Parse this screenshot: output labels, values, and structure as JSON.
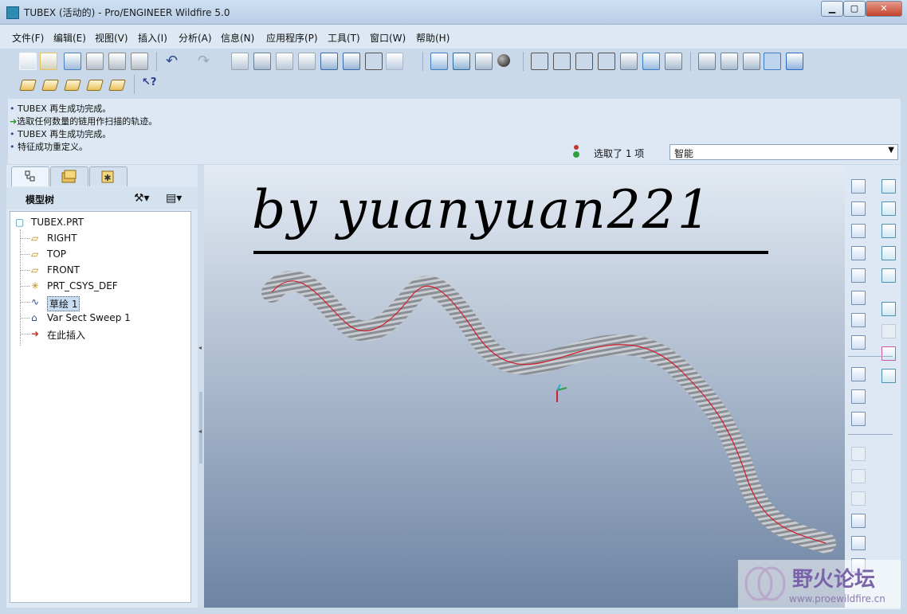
{
  "window": {
    "title": "TUBEX (活动的) - Pro/ENGINEER Wildfire 5.0",
    "min_label": "▁",
    "max_label": "▢",
    "close_label": "✕"
  },
  "menu": [
    "文件(F)",
    "编辑(E)",
    "视图(V)",
    "插入(I)",
    "分析(A)",
    "信息(N)",
    "应用程序(P)",
    "工具(T)",
    "窗口(W)",
    "帮助(H)"
  ],
  "toolbar_icons": [
    "new-icon",
    "open-icon",
    "save-icon",
    "print-icon",
    "print-preview-icon",
    "quick-print-icon",
    "undo-icon",
    "redo-icon",
    "cut-icon",
    "copy-icon",
    "paste-icon",
    "paste-special-icon",
    "regenerate-icon",
    "regen-manager-icon",
    "find-icon",
    "select-box-icon",
    "repaint-icon",
    "spin-center-icon",
    "orient-icon",
    "shading-icon",
    "zoom-in-icon",
    "zoom-out-icon",
    "refit-icon",
    "reorient-icon",
    "saved-views-icon",
    "layers-icon",
    "view-manager-icon",
    "wireframe-icon",
    "hidden-line-icon",
    "no-hidden-icon",
    "shaded-icon",
    "enhanced-realism-icon"
  ],
  "toolbar2_icons": [
    "datum-plane-toggle-icon",
    "datum-axis-toggle-icon",
    "datum-point-toggle-icon",
    "csys-toggle-icon",
    "annotation-toggle-icon",
    "context-help-icon"
  ],
  "messages": [
    {
      "icon": "bullet",
      "text": "TUBEX 再生成功完成。"
    },
    {
      "icon": "arrow",
      "text": "选取任何数量的链用作扫描的轨迹。"
    },
    {
      "icon": "bullet",
      "text": "TUBEX 再生成功完成。"
    },
    {
      "icon": "bullet",
      "text": "特征成功重定义。"
    }
  ],
  "selection": {
    "text": "选取了 1 项",
    "filter": "智能"
  },
  "model_tree": {
    "title": "模型树",
    "items": [
      {
        "label": "TUBEX.PRT",
        "icon": "part-icon"
      },
      {
        "label": "RIGHT",
        "icon": "datum-plane-icon"
      },
      {
        "label": "TOP",
        "icon": "datum-plane-icon"
      },
      {
        "label": "FRONT",
        "icon": "datum-plane-icon"
      },
      {
        "label": "PRT_CSYS_DEF",
        "icon": "csys-icon"
      },
      {
        "label": "草绘 1",
        "icon": "sketch-icon"
      },
      {
        "label": "Var Sect Sweep 1",
        "icon": "sweep-icon"
      },
      {
        "label": "在此插入",
        "icon": "insert-arrow-icon"
      }
    ]
  },
  "viewport": {
    "handwriting": "by yuanyuan221"
  },
  "watermark": {
    "cn": "野火论坛",
    "url": "www.proewildfire.cn"
  },
  "colors": {
    "accent": "#3b7cc4",
    "tube_center": "#d02030",
    "selected_row": "#c8ddf2"
  }
}
